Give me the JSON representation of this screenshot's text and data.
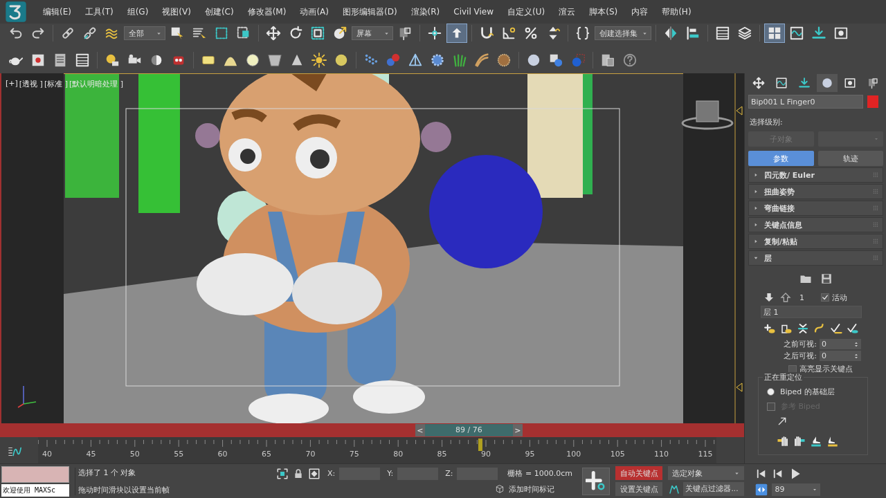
{
  "menu": [
    "编辑(E)",
    "工具(T)",
    "组(G)",
    "视图(V)",
    "创建(C)",
    "修改器(M)",
    "动画(A)",
    "图形编辑器(D)",
    "渲染(R)",
    "Civil View",
    "自定义(U)",
    "渲云",
    "脚本(S)",
    "内容",
    "帮助(H)"
  ],
  "toolbar_main": [
    {
      "kind": "button",
      "selected": false
    },
    {
      "kind": "button",
      "selected": false
    },
    {
      "kind": "separator"
    },
    {
      "kind": "button",
      "selected": false
    },
    {
      "kind": "button",
      "selected": false
    },
    {
      "kind": "button",
      "selected": false
    },
    {
      "kind": "dropdown",
      "value": "全部"
    },
    {
      "kind": "button",
      "selected": false
    },
    {
      "kind": "button",
      "selected": false
    },
    {
      "kind": "button",
      "selected": false
    },
    {
      "kind": "button",
      "selected": false
    },
    {
      "kind": "separator"
    },
    {
      "kind": "button",
      "selected": false
    },
    {
      "kind": "button",
      "selected": false
    },
    {
      "kind": "button",
      "selected": false
    },
    {
      "kind": "button",
      "selected": false
    },
    {
      "kind": "dropdown",
      "value": "屏幕"
    },
    {
      "kind": "button",
      "selected": false
    },
    {
      "kind": "separator"
    },
    {
      "kind": "button",
      "selected": false
    },
    {
      "kind": "button",
      "selected": true
    },
    {
      "kind": "separator"
    },
    {
      "kind": "button",
      "selected": false
    },
    {
      "kind": "button",
      "selected": false
    },
    {
      "kind": "button",
      "selected": false
    },
    {
      "kind": "button",
      "selected": false
    },
    {
      "kind": "separator"
    },
    {
      "kind": "button",
      "selected": false
    },
    {
      "kind": "dropdown",
      "value": "创建选择集"
    },
    {
      "kind": "separator"
    },
    {
      "kind": "button",
      "selected": false
    },
    {
      "kind": "button",
      "selected": false
    },
    {
      "kind": "separator"
    },
    {
      "kind": "button",
      "selected": false
    },
    {
      "kind": "button",
      "selected": false
    },
    {
      "kind": "separator"
    },
    {
      "kind": "button",
      "selected": true
    },
    {
      "kind": "button",
      "selected": false
    },
    {
      "kind": "button",
      "selected": false
    },
    {
      "kind": "button",
      "selected": false
    }
  ],
  "toolbar_create": [
    {
      "kind": "button",
      "selected": false
    },
    {
      "kind": "button",
      "selected": false
    },
    {
      "kind": "button",
      "selected": false
    },
    {
      "kind": "button",
      "selected": false
    },
    {
      "kind": "separator"
    },
    {
      "kind": "button",
      "selected": false
    },
    {
      "kind": "button",
      "selected": false
    },
    {
      "kind": "button",
      "selected": false
    },
    {
      "kind": "button",
      "selected": false
    },
    {
      "kind": "separator"
    },
    {
      "kind": "button",
      "selected": false
    },
    {
      "kind": "button",
      "selected": false
    },
    {
      "kind": "button",
      "selected": false
    },
    {
      "kind": "button",
      "selected": false
    },
    {
      "kind": "button",
      "selected": false
    },
    {
      "kind": "button",
      "selected": false
    },
    {
      "kind": "button",
      "selected": false
    },
    {
      "kind": "separator"
    },
    {
      "kind": "button",
      "selected": false
    },
    {
      "kind": "button",
      "selected": false
    },
    {
      "kind": "button",
      "selected": false
    },
    {
      "kind": "button",
      "selected": false
    },
    {
      "kind": "button",
      "selected": false
    },
    {
      "kind": "button",
      "selected": false
    },
    {
      "kind": "button",
      "selected": false
    },
    {
      "kind": "separator"
    },
    {
      "kind": "button",
      "selected": false
    },
    {
      "kind": "button",
      "selected": false
    },
    {
      "kind": "button",
      "selected": false
    },
    {
      "kind": "separator"
    },
    {
      "kind": "button",
      "selected": false
    },
    {
      "kind": "button",
      "selected": false
    }
  ],
  "viewport": {
    "labels": [
      "[+]",
      "[透视 ]",
      "[标准 ]",
      "[默认明暗处理 ]"
    ]
  },
  "time_slider": {
    "prev": "<",
    "label": "89 / 76",
    "next": ">",
    "level": 0.652
  },
  "ruler": {
    "labels": [
      "40",
      "45",
      "50",
      "55",
      "60",
      "65",
      "70",
      "75",
      "80",
      "85",
      "90",
      "95",
      "100",
      "105",
      "110",
      "115"
    ]
  },
  "command_panel": {
    "tabs": [
      {
        "selected": false
      },
      {
        "selected": false
      },
      {
        "selected": false
      },
      {
        "selected": true
      },
      {
        "selected": false
      },
      {
        "selected": false
      }
    ],
    "object_name": {
      "value": "Bip001 L Finger0",
      "color": "#e02424"
    },
    "selection_label": "选择级别:",
    "selection_controls": [
      {
        "kind": "button",
        "label": "子对象",
        "disabled": true
      },
      {
        "kind": "dropdown",
        "disabled": true
      }
    ],
    "modes": [
      {
        "label": "参数",
        "selected": true
      },
      {
        "label": "轨迹",
        "selected": false
      }
    ],
    "rollouts": [
      {
        "title": "四元数/ Euler",
        "expanded": false
      },
      {
        "title": "扭曲姿势",
        "expanded": false
      },
      {
        "title": "弯曲链接",
        "expanded": false
      },
      {
        "title": "关键点信息",
        "expanded": false
      },
      {
        "title": "复制/粘贴",
        "expanded": false
      },
      {
        "title": "层",
        "expanded": true
      }
    ],
    "layers": {
      "index": "1",
      "active": {
        "label": "活动",
        "checked": true
      },
      "name": "层 1",
      "spinners": [
        {
          "label": "之前可视:",
          "value": "0"
        },
        {
          "label": "之后可视:",
          "value": "0"
        }
      ],
      "highlight": {
        "label": "高亮显示关键点",
        "checked": false
      },
      "retarget": {
        "title": "正在重定位",
        "options": [
          {
            "kind": "radio",
            "label": "Biped 的基础层",
            "selected": true,
            "disabled": false
          },
          {
            "kind": "checkbox",
            "label": "参考 Biped",
            "checked": false,
            "disabled": true
          }
        ]
      }
    }
  },
  "status": {
    "listener": "欢迎使用 MAXSc",
    "prompt": "选择了 1 个 对象",
    "hint": "拖动时间滑块以设置当前帧",
    "coords": [
      {
        "label": "X:"
      },
      {
        "label": "Y:"
      },
      {
        "label": "Z:"
      }
    ],
    "grid": "栅格 = 1000.0cm",
    "add_tag": "添加时间标记",
    "auto_key": {
      "label": "自动关键点",
      "on": true
    },
    "set_key": "设置关键点",
    "key_mode": "选定对象",
    "key_filters": "关键点过滤器...",
    "frame": "89"
  }
}
